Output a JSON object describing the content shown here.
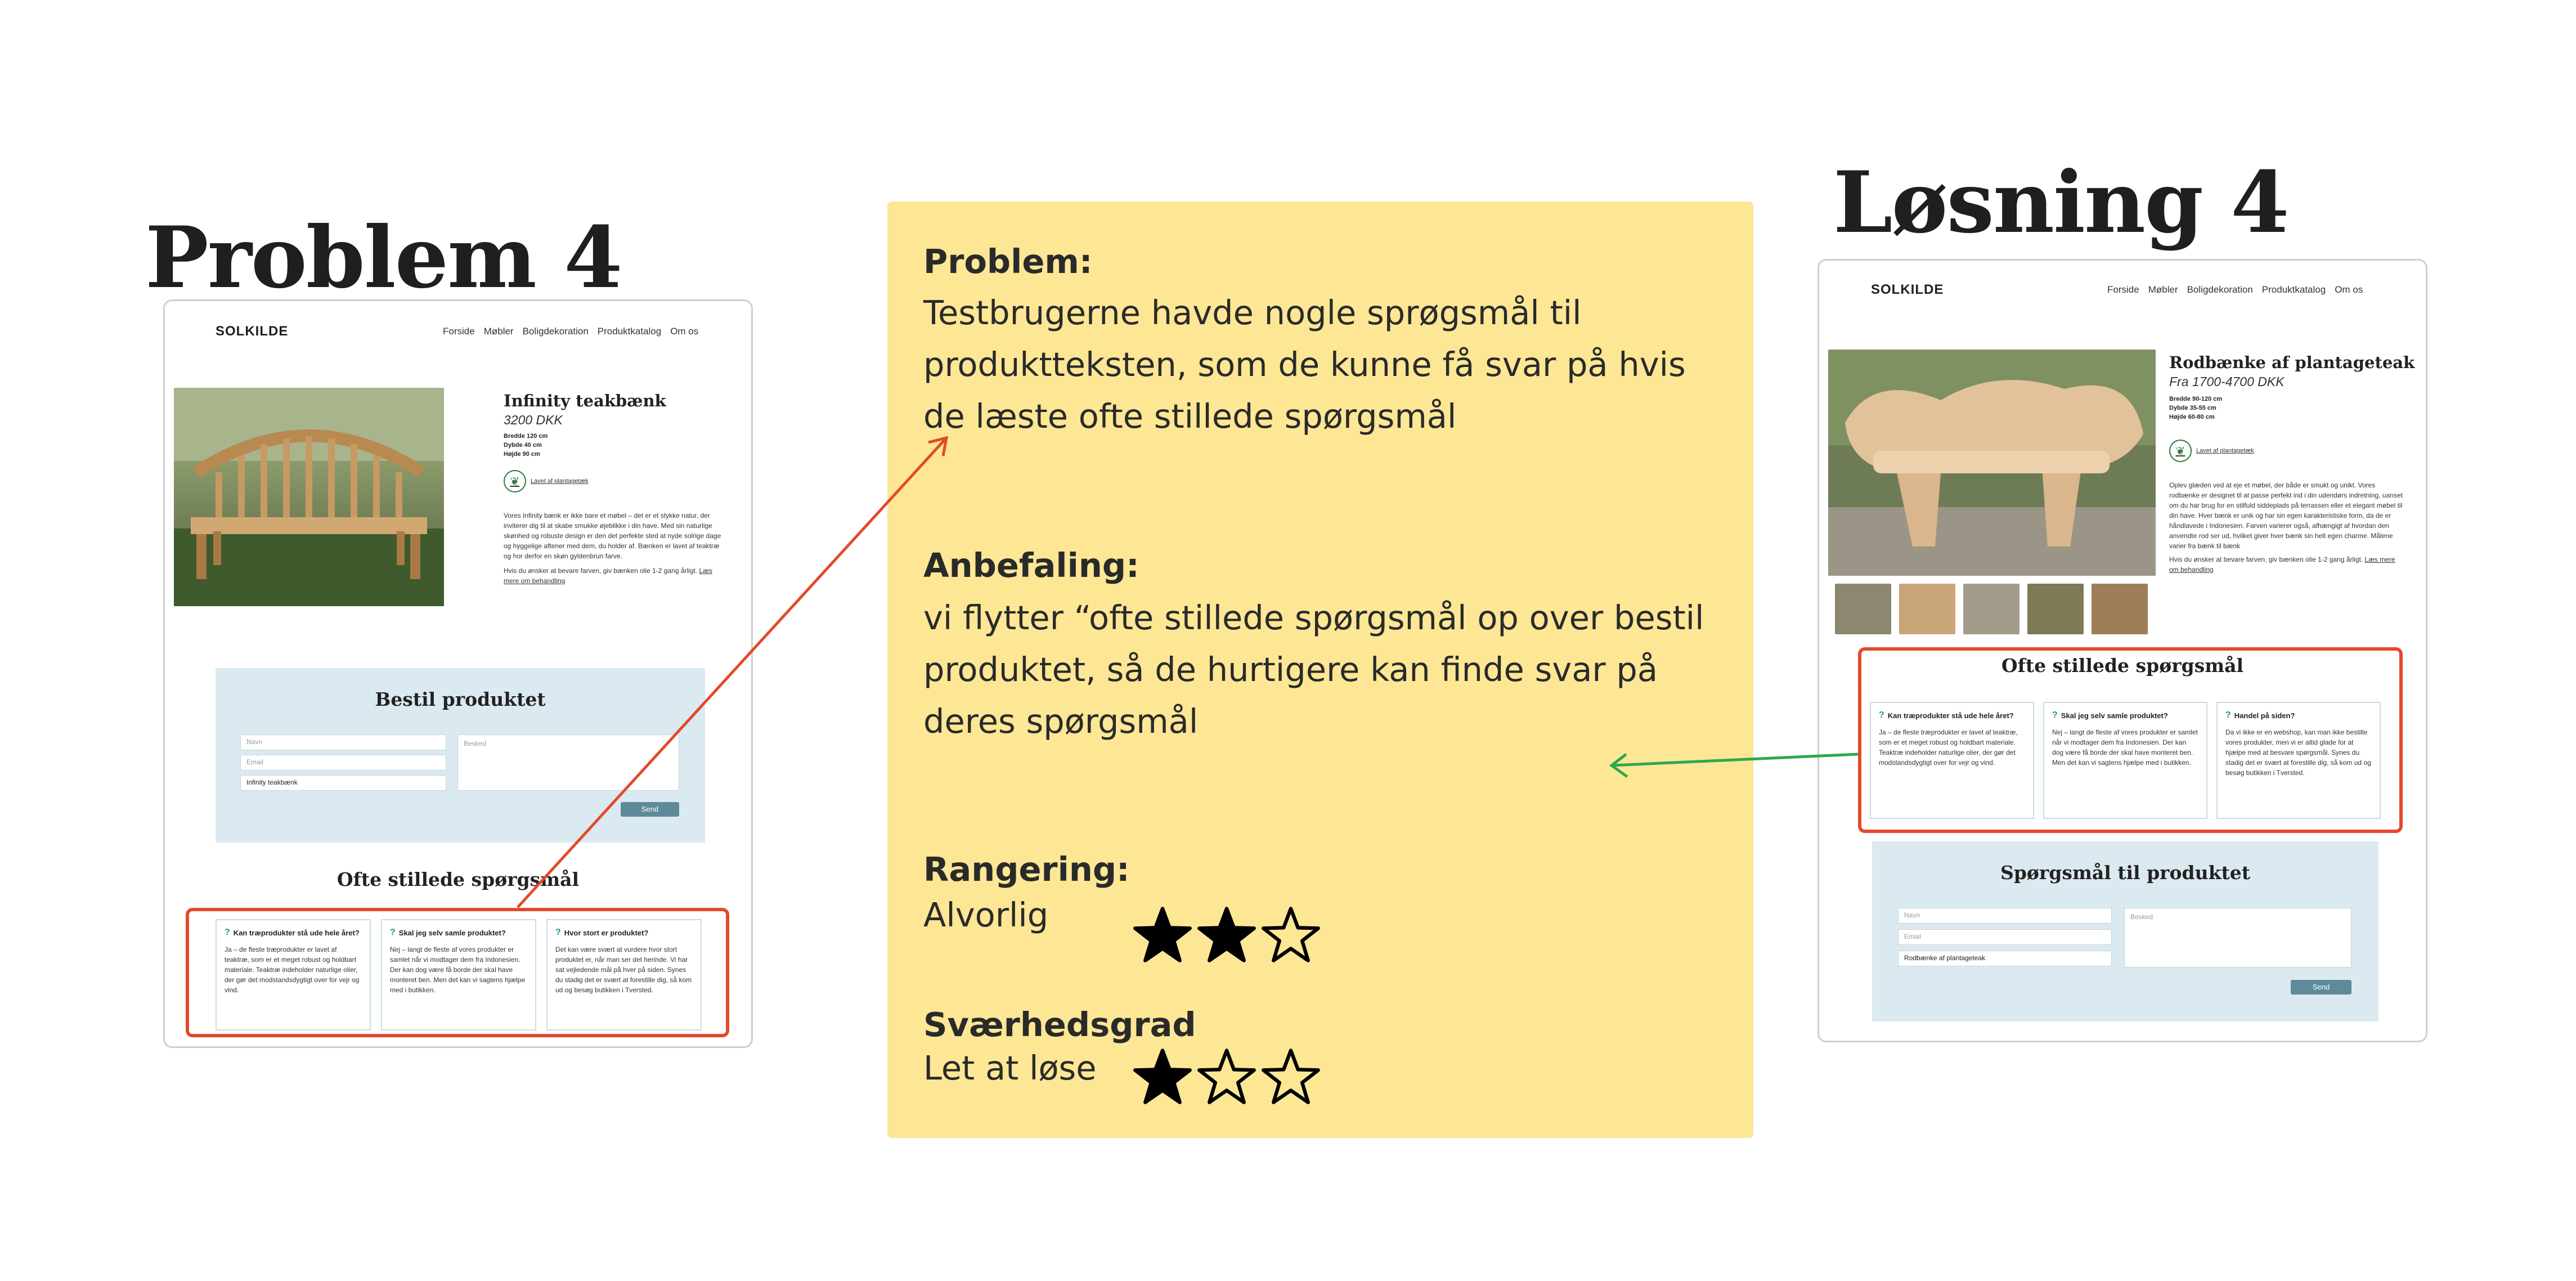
{
  "problem_heading": "Problem 4",
  "solution_heading": "Løsning 4",
  "left_site": {
    "logo": "SOLKILDE",
    "nav": [
      "Forside",
      "Møbler",
      "Boligdekoration",
      "Produktkatalog",
      "Om os"
    ],
    "product": {
      "title": "Infinity teakbænk",
      "price": "3200 DKK",
      "dims": [
        "Bredde 120 cm",
        "Dybde 40 cm",
        "Højde 90 cm"
      ],
      "badge_label": "Lavet af plantagetæk",
      "description": "Vores Infinity bænk er ikke bare et møbel – det er et stykke natur, der inviterer dig til at skabe smukke øjeblikke i din have. Med sin naturlige skønhed og robuste design er den det perfekte sted at nyde solrige dage og hyggelige aftener med dem, du holder af. Bænken er lavet af teaktræ og hor derfor en skøn gyldenbrun farve.",
      "care_text": "Hvis du ønsker at bevare farven, giv bænken olie 1-2 gang årligt.",
      "care_link": "Læs mere om behandling"
    },
    "order": {
      "title": "Bestil produktet",
      "name_placeholder": "Navn",
      "email_placeholder": "Email",
      "product_value": "Infinity teakbænk",
      "message_placeholder": "Besked",
      "send": "Send"
    },
    "faq": {
      "title": "Ofte stillede spørgsmål",
      "items": [
        {
          "q": "Kan træprodukter stå ude hele året?",
          "a": "Ja – de fleste træprodukter er lavet af teaktræ, som er et meget robust og holdbart materiale. Teaktræ indeholder naturlige olier, der gør det modstandsdygtigt over for vejr og vind."
        },
        {
          "q": "Skal jeg selv samle produktet?",
          "a": "Nej – langt de fleste af vores produkter er samlet når vi modtager dem fra Indonesien. Der kan dog være få borde der skal have monteret ben. Men det kan vi sagtens hjælpe med i butikken."
        },
        {
          "q": "Hvor stort er produktet?",
          "a": "Det kan være svært at vurdere hvor stort produktet er, når man ser det herinde. Vi har sat vejledende mål på hver på siden. Synes du stadig det er svært at forestille dig, så kom ud og besøg butikken i Tversted."
        }
      ]
    }
  },
  "note": {
    "problem_label": "Problem:",
    "problem_text": "Testbrugerne havde nogle sprøgsmål til produktteksten, som de kunne få svar på hvis de læste ofte stillede spørgsmål",
    "recommendation_label": "Anbefaling:",
    "recommendation_text": "vi flytter “ofte stillede spørgsmål op over bestil produktet, så de hurtigere kan finde svar på deres spørgsmål",
    "rating_label": "Rangering:",
    "rating_value": "Alvorlig",
    "rating_stars": 2,
    "difficulty_label": "Sværhedsgrad",
    "difficulty_value": "Let at løse",
    "difficulty_stars": 1,
    "stars_total": 3
  },
  "right_site": {
    "logo": "SOLKILDE",
    "nav": [
      "Forside",
      "Møbler",
      "Boligdekoration",
      "Produktkatalog",
      "Om os"
    ],
    "product": {
      "title": "Rodbænke af plantageteak",
      "price": "Fra 1700-4700 DKK",
      "dims": [
        "Bredde 90-120 cm",
        "Dybde 35-55 cm",
        "Højde 60-80 cm"
      ],
      "badge_label": "Lavet af plantagetæk",
      "description": "Oplev glæden ved at eje et møbel, der både er smukt og unikt. Vores rodbænke er designet til at passe perfekt ind i din udendørs indretning, uanset om du har brug for en stilfuld siddeplads på terrassen eller et elegant møbel til din have. Hver bænk er unik og har sin egen karakteristiske form, da de er håndlavede i Indonesien. Farven varierer også, afhængigt af hvordan den anvendte rod ser ud, hvilket giver hver bænk sin helt egen charme. Målene varier fra bænk til bænk",
      "care_text": "Hvis du ønsker at bevare farven, giv bænken olie 1-2 gang årligt.",
      "care_link": "Læs mere om behandling"
    },
    "faq": {
      "title": "Ofte stillede spørgsmål",
      "items": [
        {
          "q": "Kan træprodukter stå ude hele året?",
          "a": "Ja – de fleste træprodukter er lavet af teaktræ, som er et meget robust og holdbart materiale. Teaktræ indeholder naturlige olier, der gør det modstandsdygtigt over for vejr og vind."
        },
        {
          "q": "Skal jeg selv samle produktet?",
          "a": "Nej – langt de fleste af vores produkter er samlet når vi modtager dem fra Indonesien. Der kan dog være få borde der skal have monteret ben. Men det kan vi sagtens hjælpe med i butikken."
        },
        {
          "q": "Handel på siden?",
          "a": "Da vi ikke er en webshop, kan man ikke bestille vores produkter, men vi er altid glade for at hjælpe med at besvare spørgsmål. Synes du stadig det er svært at forestille dig, så kom ud og besøg butikken i Tversted."
        }
      ]
    },
    "contact": {
      "title": "Spørgsmål til produktet",
      "name_placeholder": "Navn",
      "email_placeholder": "Email",
      "product_value": "Rodbænke af plantageteak",
      "message_placeholder": "Besked",
      "send": "Send"
    }
  },
  "colors": {
    "note_bg": "#fde795",
    "highlight": "#e24a2b",
    "arrow_red": "#e24a2b",
    "arrow_green": "#2fa84f",
    "form_bg": "#dbeaf0",
    "button": "#5f8a99"
  }
}
